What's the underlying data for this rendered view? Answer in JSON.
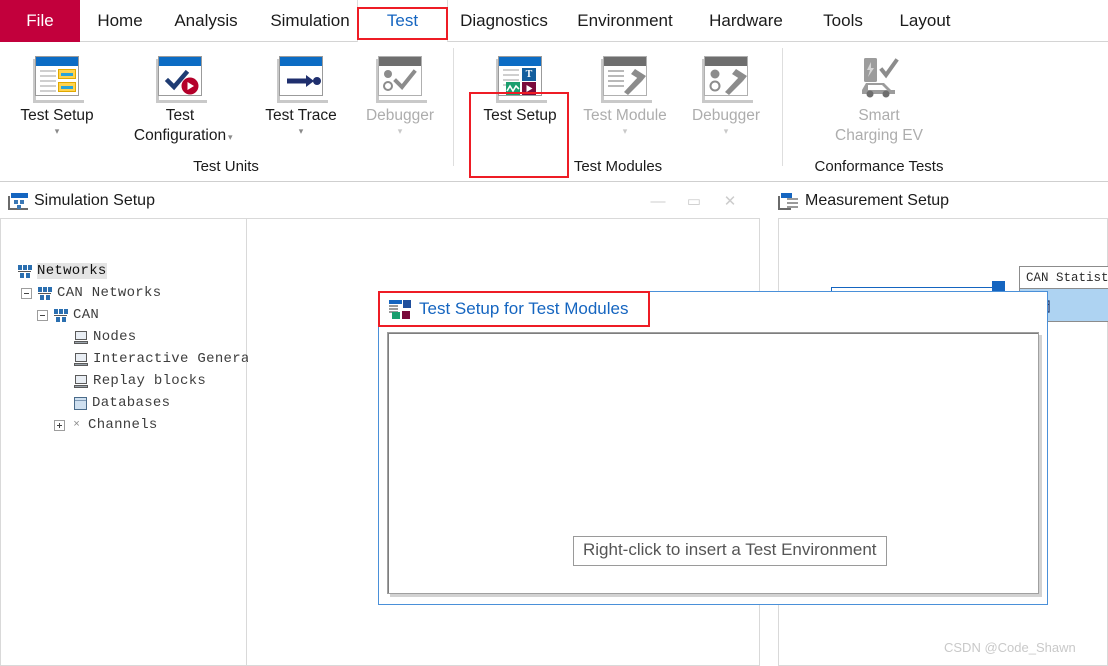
{
  "menu": {
    "file_label": "File",
    "tabs": [
      {
        "label": "Home",
        "active": false
      },
      {
        "label": "Analysis",
        "active": false
      },
      {
        "label": "Simulation",
        "active": false
      },
      {
        "label": "Test",
        "active": true
      },
      {
        "label": "Diagnostics",
        "active": false
      },
      {
        "label": "Environment",
        "active": false
      },
      {
        "label": "Hardware",
        "active": false
      },
      {
        "label": "Tools",
        "active": false
      },
      {
        "label": "Layout",
        "active": false
      }
    ]
  },
  "ribbon": {
    "groups": [
      {
        "name": "Test Units",
        "label": "Test Units"
      },
      {
        "name": "Test Modules",
        "label": "Test Modules"
      },
      {
        "name": "Conformance Tests",
        "label": "Conformance Tests"
      }
    ],
    "items": {
      "test_setup_units": {
        "label": "Test Setup",
        "enabled": true,
        "has_caret": true
      },
      "test_configuration": {
        "label": "Test\nConfiguration",
        "enabled": true,
        "has_caret": true
      },
      "test_trace": {
        "label": "Test Trace",
        "enabled": true,
        "has_caret": true
      },
      "debugger_units": {
        "label": "Debugger",
        "enabled": false,
        "has_caret": true
      },
      "test_setup_modules": {
        "label": "Test Setup",
        "enabled": true,
        "has_caret": false,
        "highlighted": true
      },
      "test_module": {
        "label": "Test Module",
        "enabled": false,
        "has_caret": true
      },
      "debugger_modules": {
        "label": "Debugger",
        "enabled": false,
        "has_caret": true
      },
      "smart_charging_ev": {
        "label": "Smart\nCharging EV",
        "enabled": false,
        "has_caret": false
      }
    },
    "icon_letter_t": "T"
  },
  "simulation_setup": {
    "title": "Simulation Setup",
    "window_controls": {
      "minimize": "—",
      "maximize": "▭",
      "close": "✕"
    },
    "tree": [
      {
        "label": "Networks",
        "icon": "network-icon",
        "indent": 0,
        "expander": "none",
        "selected": true
      },
      {
        "label": "CAN Networks",
        "icon": "network-icon",
        "indent": 1,
        "expander": "minus",
        "selected": false
      },
      {
        "label": "CAN",
        "icon": "network-icon",
        "indent": 2,
        "expander": "minus",
        "selected": false
      },
      {
        "label": "Nodes",
        "icon": "node-icon",
        "indent": 4,
        "expander": "none",
        "selected": false
      },
      {
        "label": "Interactive Genera",
        "icon": "node-icon",
        "indent": 4,
        "expander": "none",
        "selected": false
      },
      {
        "label": "Replay blocks",
        "icon": "node-icon",
        "indent": 4,
        "expander": "none",
        "selected": false
      },
      {
        "label": "Databases",
        "icon": "database-icon",
        "indent": 4,
        "expander": "none",
        "selected": false
      },
      {
        "label": "Channels",
        "icon": "channel-icon",
        "indent": 3,
        "expander": "plus",
        "selected": false
      }
    ]
  },
  "measurement_setup": {
    "title": "Measurement Setup",
    "block_label": "CAN Statistics"
  },
  "test_setup_dialog": {
    "title": "Test Setup for Test Modules",
    "hint": "Right-click to insert a Test Environment"
  },
  "watermark": "CSDN @Code_Shawn",
  "colors": {
    "file_tab": "#c2003c",
    "accent_blue": "#1565c0",
    "highlight_red": "#ee1c25",
    "block_fill": "#aed3f2"
  }
}
